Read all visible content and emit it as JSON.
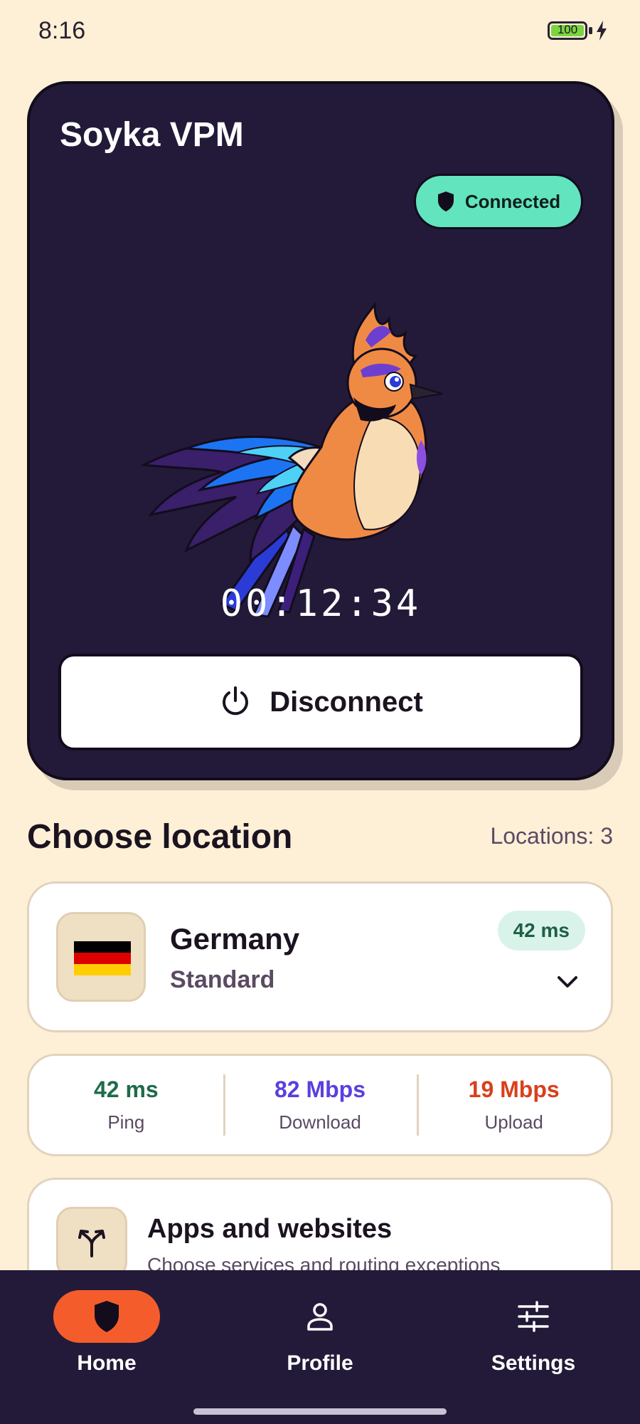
{
  "status_bar": {
    "time": "8:16",
    "battery_level": "100"
  },
  "hero": {
    "app_title": "Soyka VPM",
    "status": "Connected",
    "timer": "00:12:34",
    "disconnect_label": "Disconnect",
    "colors": {
      "background": "#231a39",
      "status_pill": "#62e4be"
    }
  },
  "location_section": {
    "title": "Choose location",
    "count_label": "Locations: 3",
    "selected": {
      "name": "Germany",
      "tier": "Standard",
      "ping": "42 ms",
      "flag_colors": [
        "#000000",
        "#dd0000",
        "#ffce00"
      ]
    }
  },
  "stats": [
    {
      "value": "42 ms",
      "label": "Ping",
      "color": "#1e6b4a"
    },
    {
      "value": "82 Mbps",
      "label": "Download",
      "color": "#5b3fe0"
    },
    {
      "value": "19 Mbps",
      "label": "Upload",
      "color": "#d8401c"
    }
  ],
  "apps_card": {
    "title": "Apps and websites",
    "subtitle": "Choose services and routing exceptions"
  },
  "nav": {
    "items": [
      {
        "label": "Home",
        "icon": "shield-icon",
        "active": true
      },
      {
        "label": "Profile",
        "icon": "person-icon",
        "active": false
      },
      {
        "label": "Settings",
        "icon": "sliders-icon",
        "active": false
      }
    ],
    "accent": "#f45d2b"
  }
}
